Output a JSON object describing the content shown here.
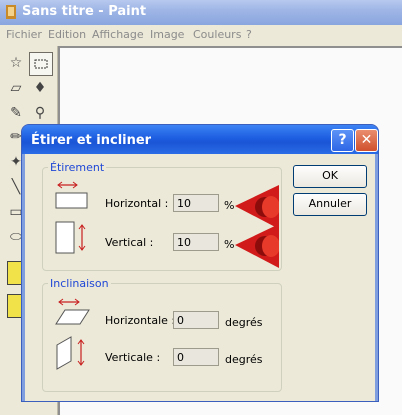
{
  "window": {
    "title": "Sans titre - Paint"
  },
  "menu": [
    "Fichier",
    "Edition",
    "Affichage",
    "Image",
    "Couleurs",
    "?"
  ],
  "dialog": {
    "title": "Étirer et incliner",
    "help": "?",
    "close": "✕",
    "stretch": {
      "legend": "Étirement",
      "horizontal_label": "Horizontal :",
      "horizontal_value": "10",
      "horizontal_unit": "%",
      "vertical_label": "Vertical :",
      "vertical_value": "10",
      "vertical_unit": "%"
    },
    "skew": {
      "legend": "Inclinaison",
      "horizontal_label": "Horizontale :",
      "horizontal_value": "0",
      "horizontal_unit": "degrés",
      "vertical_label": "Verticale :",
      "vertical_value": "0",
      "vertical_unit": "degrés"
    },
    "ok_label": "OK",
    "cancel_label": "Annuler"
  },
  "colors": {
    "accent_red": "#d11a1a",
    "legend_blue": "#1f47d6"
  }
}
